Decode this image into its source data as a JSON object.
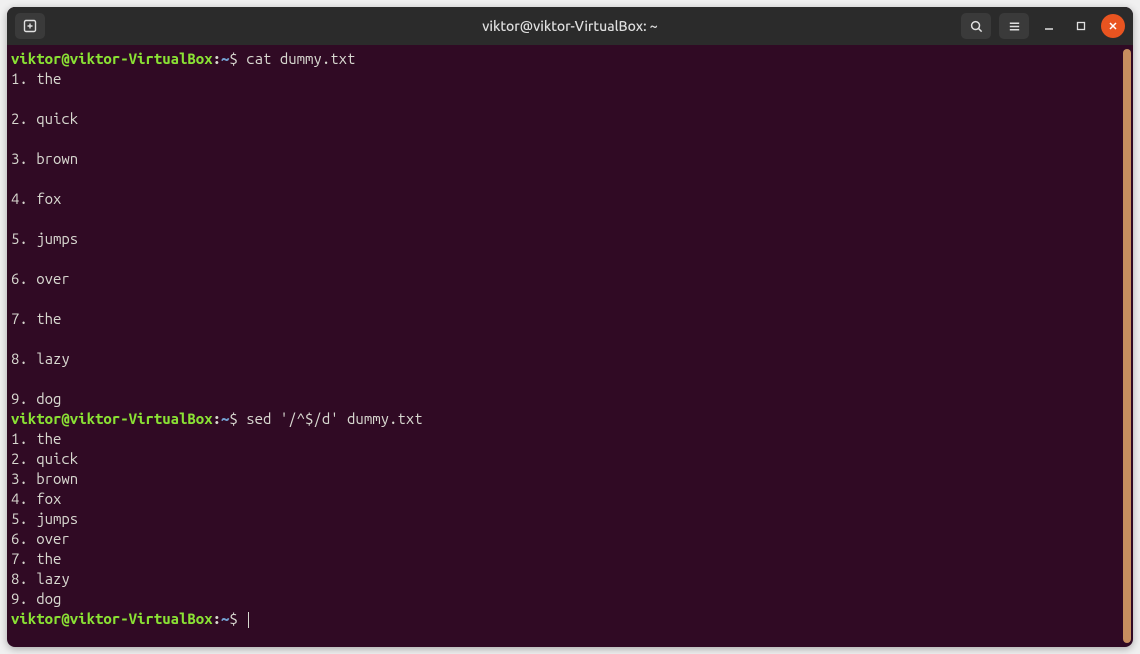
{
  "window": {
    "title": "viktor@viktor-VirtualBox: ~"
  },
  "prompt": {
    "user_host": "viktor@viktor-VirtualBox",
    "separator": ":",
    "path": "~",
    "symbol": "$"
  },
  "session": [
    {
      "type": "command",
      "cmd": "cat dummy.txt"
    },
    {
      "type": "output",
      "lines": [
        "1. the",
        "",
        "2. quick",
        "",
        "3. brown",
        "",
        "4. fox",
        "",
        "5. jumps",
        "",
        "6. over",
        "",
        "7. the",
        "",
        "8. lazy",
        "",
        "9. dog"
      ]
    },
    {
      "type": "command",
      "cmd": "sed '/^$/d' dummy.txt"
    },
    {
      "type": "output",
      "lines": [
        "1. the",
        "2. quick",
        "3. brown",
        "4. fox",
        "5. jumps",
        "6. over",
        "7. the",
        "8. lazy",
        "9. dog"
      ]
    },
    {
      "type": "prompt_only"
    }
  ],
  "icons": {
    "new_tab": "new-tab-icon",
    "search": "search-icon",
    "menu": "hamburger-icon",
    "minimize": "minimize-icon",
    "maximize": "maximize-icon",
    "close": "close-icon"
  }
}
